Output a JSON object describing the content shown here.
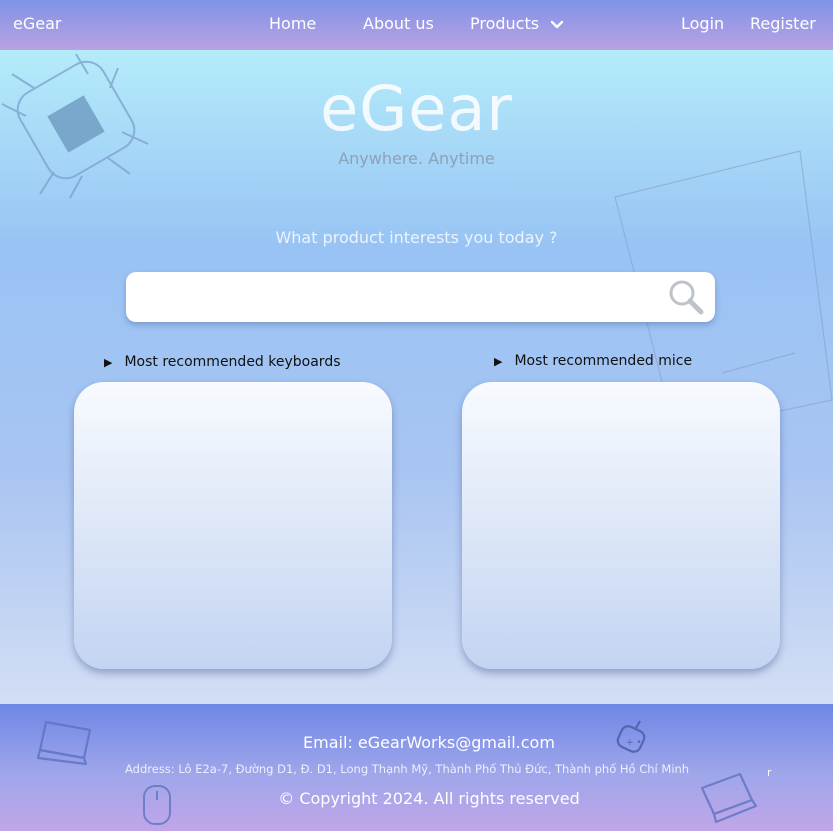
{
  "nav": {
    "brand": "eGear",
    "home": "Home",
    "about": "About us",
    "products": "Products",
    "login": "Login",
    "register": "Register"
  },
  "hero": {
    "title": "eGear",
    "tagline": "Anywhere. Anytime",
    "question": "What product interests you today ?"
  },
  "search": {
    "value": "",
    "placeholder": ""
  },
  "sections": {
    "keyboards_label": "Most recommended keyboards",
    "mice_label": "Most recommended mice"
  },
  "footer": {
    "email": "Email: eGearWorks@gmail.com",
    "address": "Address: Lô E2a-7, Đường D1, Đ. D1, Long Thạnh Mỹ, Thành Phố Thủ Đức, Thành phố Hồ Chí Minh",
    "stray": "r",
    "copyright": "© Copyright 2024. All rights reserved"
  },
  "icons": {
    "chevron": "chevron-down-icon",
    "search": "search-icon",
    "chip": "chip-icon",
    "laptop": "laptop-icon",
    "mouse": "mouse-icon",
    "gamepad": "gamepad-icon"
  },
  "colors": {
    "nav_start": "#7f93e6",
    "nav_end": "#b9a2e4",
    "hero_top": "#b4ecfa",
    "hero_bottom": "#d3def4",
    "footer_start": "#6e87e6",
    "footer_end": "#c0a6e8"
  }
}
